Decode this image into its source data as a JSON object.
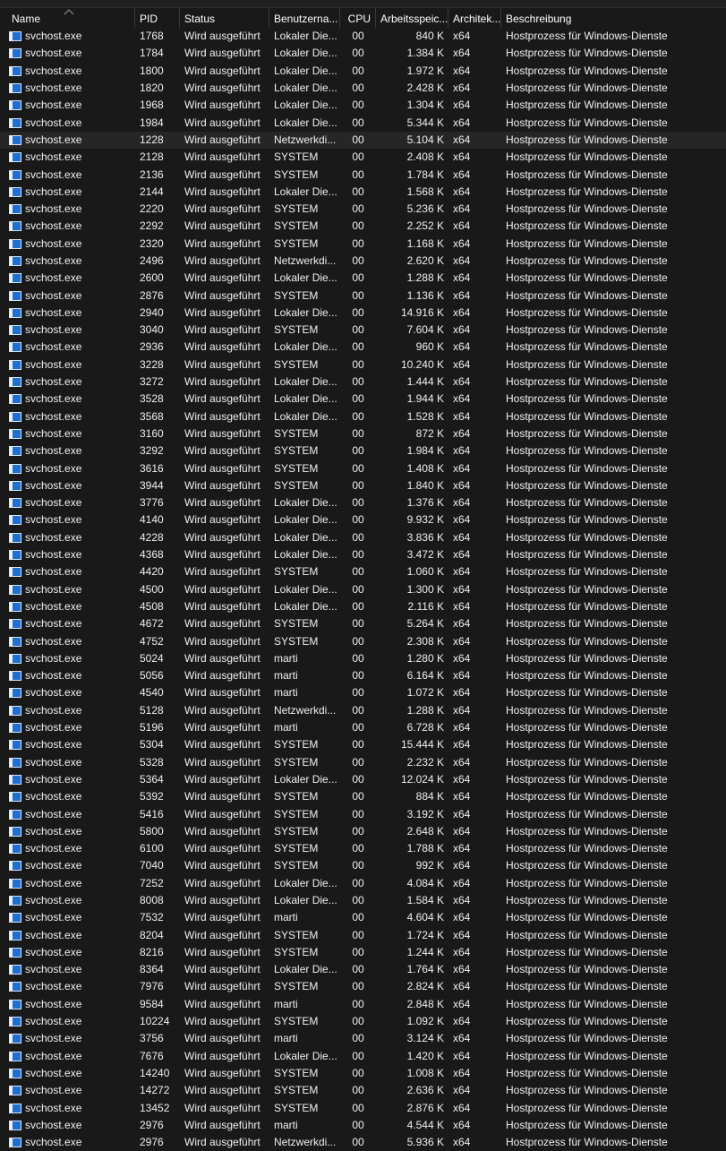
{
  "columns": {
    "name": "Name",
    "pid": "PID",
    "status": "Status",
    "user": "Benutzerna...",
    "cpu": "CPU",
    "memory": "Arbeitsspeic...",
    "arch": "Architek...",
    "description": "Beschreibung"
  },
  "sort_column": "Name",
  "icon_color": "#1f6fd1",
  "processes": [
    {
      "name": "svchost.exe",
      "pid": "1768",
      "status": "Wird ausgeführt",
      "user": "Lokaler Die...",
      "cpu": "00",
      "mem": "840 K",
      "arch": "x64",
      "desc": "Hostprozess für Windows-Dienste"
    },
    {
      "name": "svchost.exe",
      "pid": "1784",
      "status": "Wird ausgeführt",
      "user": "Lokaler Die...",
      "cpu": "00",
      "mem": "1.384 K",
      "arch": "x64",
      "desc": "Hostprozess für Windows-Dienste"
    },
    {
      "name": "svchost.exe",
      "pid": "1800",
      "status": "Wird ausgeführt",
      "user": "Lokaler Die...",
      "cpu": "00",
      "mem": "1.972 K",
      "arch": "x64",
      "desc": "Hostprozess für Windows-Dienste"
    },
    {
      "name": "svchost.exe",
      "pid": "1820",
      "status": "Wird ausgeführt",
      "user": "Lokaler Die...",
      "cpu": "00",
      "mem": "2.428 K",
      "arch": "x64",
      "desc": "Hostprozess für Windows-Dienste"
    },
    {
      "name": "svchost.exe",
      "pid": "1968",
      "status": "Wird ausgeführt",
      "user": "Lokaler Die...",
      "cpu": "00",
      "mem": "1.304 K",
      "arch": "x64",
      "desc": "Hostprozess für Windows-Dienste"
    },
    {
      "name": "svchost.exe",
      "pid": "1984",
      "status": "Wird ausgeführt",
      "user": "Lokaler Die...",
      "cpu": "00",
      "mem": "5.344 K",
      "arch": "x64",
      "desc": "Hostprozess für Windows-Dienste"
    },
    {
      "name": "svchost.exe",
      "pid": "1228",
      "status": "Wird ausgeführt",
      "user": "Netzwerkdi...",
      "cpu": "00",
      "mem": "5.104 K",
      "arch": "x64",
      "desc": "Hostprozess für Windows-Dienste",
      "selected": true
    },
    {
      "name": "svchost.exe",
      "pid": "2128",
      "status": "Wird ausgeführt",
      "user": "SYSTEM",
      "cpu": "00",
      "mem": "2.408 K",
      "arch": "x64",
      "desc": "Hostprozess für Windows-Dienste"
    },
    {
      "name": "svchost.exe",
      "pid": "2136",
      "status": "Wird ausgeführt",
      "user": "SYSTEM",
      "cpu": "00",
      "mem": "1.784 K",
      "arch": "x64",
      "desc": "Hostprozess für Windows-Dienste"
    },
    {
      "name": "svchost.exe",
      "pid": "2144",
      "status": "Wird ausgeführt",
      "user": "Lokaler Die...",
      "cpu": "00",
      "mem": "1.568 K",
      "arch": "x64",
      "desc": "Hostprozess für Windows-Dienste"
    },
    {
      "name": "svchost.exe",
      "pid": "2220",
      "status": "Wird ausgeführt",
      "user": "SYSTEM",
      "cpu": "00",
      "mem": "5.236 K",
      "arch": "x64",
      "desc": "Hostprozess für Windows-Dienste"
    },
    {
      "name": "svchost.exe",
      "pid": "2292",
      "status": "Wird ausgeführt",
      "user": "SYSTEM",
      "cpu": "00",
      "mem": "2.252 K",
      "arch": "x64",
      "desc": "Hostprozess für Windows-Dienste"
    },
    {
      "name": "svchost.exe",
      "pid": "2320",
      "status": "Wird ausgeführt",
      "user": "SYSTEM",
      "cpu": "00",
      "mem": "1.168 K",
      "arch": "x64",
      "desc": "Hostprozess für Windows-Dienste"
    },
    {
      "name": "svchost.exe",
      "pid": "2496",
      "status": "Wird ausgeführt",
      "user": "Netzwerkdi...",
      "cpu": "00",
      "mem": "2.620 K",
      "arch": "x64",
      "desc": "Hostprozess für Windows-Dienste"
    },
    {
      "name": "svchost.exe",
      "pid": "2600",
      "status": "Wird ausgeführt",
      "user": "Lokaler Die...",
      "cpu": "00",
      "mem": "1.288 K",
      "arch": "x64",
      "desc": "Hostprozess für Windows-Dienste"
    },
    {
      "name": "svchost.exe",
      "pid": "2876",
      "status": "Wird ausgeführt",
      "user": "SYSTEM",
      "cpu": "00",
      "mem": "1.136 K",
      "arch": "x64",
      "desc": "Hostprozess für Windows-Dienste"
    },
    {
      "name": "svchost.exe",
      "pid": "2940",
      "status": "Wird ausgeführt",
      "user": "Lokaler Die...",
      "cpu": "00",
      "mem": "14.916 K",
      "arch": "x64",
      "desc": "Hostprozess für Windows-Dienste"
    },
    {
      "name": "svchost.exe",
      "pid": "3040",
      "status": "Wird ausgeführt",
      "user": "SYSTEM",
      "cpu": "00",
      "mem": "7.604 K",
      "arch": "x64",
      "desc": "Hostprozess für Windows-Dienste"
    },
    {
      "name": "svchost.exe",
      "pid": "2936",
      "status": "Wird ausgeführt",
      "user": "Lokaler Die...",
      "cpu": "00",
      "mem": "960 K",
      "arch": "x64",
      "desc": "Hostprozess für Windows-Dienste"
    },
    {
      "name": "svchost.exe",
      "pid": "3228",
      "status": "Wird ausgeführt",
      "user": "SYSTEM",
      "cpu": "00",
      "mem": "10.240 K",
      "arch": "x64",
      "desc": "Hostprozess für Windows-Dienste"
    },
    {
      "name": "svchost.exe",
      "pid": "3272",
      "status": "Wird ausgeführt",
      "user": "Lokaler Die...",
      "cpu": "00",
      "mem": "1.444 K",
      "arch": "x64",
      "desc": "Hostprozess für Windows-Dienste"
    },
    {
      "name": "svchost.exe",
      "pid": "3528",
      "status": "Wird ausgeführt",
      "user": "Lokaler Die...",
      "cpu": "00",
      "mem": "1.944 K",
      "arch": "x64",
      "desc": "Hostprozess für Windows-Dienste"
    },
    {
      "name": "svchost.exe",
      "pid": "3568",
      "status": "Wird ausgeführt",
      "user": "Lokaler Die...",
      "cpu": "00",
      "mem": "1.528 K",
      "arch": "x64",
      "desc": "Hostprozess für Windows-Dienste"
    },
    {
      "name": "svchost.exe",
      "pid": "3160",
      "status": "Wird ausgeführt",
      "user": "SYSTEM",
      "cpu": "00",
      "mem": "872 K",
      "arch": "x64",
      "desc": "Hostprozess für Windows-Dienste"
    },
    {
      "name": "svchost.exe",
      "pid": "3292",
      "status": "Wird ausgeführt",
      "user": "SYSTEM",
      "cpu": "00",
      "mem": "1.984 K",
      "arch": "x64",
      "desc": "Hostprozess für Windows-Dienste"
    },
    {
      "name": "svchost.exe",
      "pid": "3616",
      "status": "Wird ausgeführt",
      "user": "SYSTEM",
      "cpu": "00",
      "mem": "1.408 K",
      "arch": "x64",
      "desc": "Hostprozess für Windows-Dienste"
    },
    {
      "name": "svchost.exe",
      "pid": "3944",
      "status": "Wird ausgeführt",
      "user": "SYSTEM",
      "cpu": "00",
      "mem": "1.840 K",
      "arch": "x64",
      "desc": "Hostprozess für Windows-Dienste"
    },
    {
      "name": "svchost.exe",
      "pid": "3776",
      "status": "Wird ausgeführt",
      "user": "Lokaler Die...",
      "cpu": "00",
      "mem": "1.376 K",
      "arch": "x64",
      "desc": "Hostprozess für Windows-Dienste"
    },
    {
      "name": "svchost.exe",
      "pid": "4140",
      "status": "Wird ausgeführt",
      "user": "Lokaler Die...",
      "cpu": "00",
      "mem": "9.932 K",
      "arch": "x64",
      "desc": "Hostprozess für Windows-Dienste"
    },
    {
      "name": "svchost.exe",
      "pid": "4228",
      "status": "Wird ausgeführt",
      "user": "Lokaler Die...",
      "cpu": "00",
      "mem": "3.836 K",
      "arch": "x64",
      "desc": "Hostprozess für Windows-Dienste"
    },
    {
      "name": "svchost.exe",
      "pid": "4368",
      "status": "Wird ausgeführt",
      "user": "Lokaler Die...",
      "cpu": "00",
      "mem": "3.472 K",
      "arch": "x64",
      "desc": "Hostprozess für Windows-Dienste"
    },
    {
      "name": "svchost.exe",
      "pid": "4420",
      "status": "Wird ausgeführt",
      "user": "SYSTEM",
      "cpu": "00",
      "mem": "1.060 K",
      "arch": "x64",
      "desc": "Hostprozess für Windows-Dienste"
    },
    {
      "name": "svchost.exe",
      "pid": "4500",
      "status": "Wird ausgeführt",
      "user": "Lokaler Die...",
      "cpu": "00",
      "mem": "1.300 K",
      "arch": "x64",
      "desc": "Hostprozess für Windows-Dienste"
    },
    {
      "name": "svchost.exe",
      "pid": "4508",
      "status": "Wird ausgeführt",
      "user": "Lokaler Die...",
      "cpu": "00",
      "mem": "2.116 K",
      "arch": "x64",
      "desc": "Hostprozess für Windows-Dienste"
    },
    {
      "name": "svchost.exe",
      "pid": "4672",
      "status": "Wird ausgeführt",
      "user": "SYSTEM",
      "cpu": "00",
      "mem": "5.264 K",
      "arch": "x64",
      "desc": "Hostprozess für Windows-Dienste"
    },
    {
      "name": "svchost.exe",
      "pid": "4752",
      "status": "Wird ausgeführt",
      "user": "SYSTEM",
      "cpu": "00",
      "mem": "2.308 K",
      "arch": "x64",
      "desc": "Hostprozess für Windows-Dienste"
    },
    {
      "name": "svchost.exe",
      "pid": "5024",
      "status": "Wird ausgeführt",
      "user": "marti",
      "cpu": "00",
      "mem": "1.280 K",
      "arch": "x64",
      "desc": "Hostprozess für Windows-Dienste"
    },
    {
      "name": "svchost.exe",
      "pid": "5056",
      "status": "Wird ausgeführt",
      "user": "marti",
      "cpu": "00",
      "mem": "6.164 K",
      "arch": "x64",
      "desc": "Hostprozess für Windows-Dienste"
    },
    {
      "name": "svchost.exe",
      "pid": "4540",
      "status": "Wird ausgeführt",
      "user": "marti",
      "cpu": "00",
      "mem": "1.072 K",
      "arch": "x64",
      "desc": "Hostprozess für Windows-Dienste"
    },
    {
      "name": "svchost.exe",
      "pid": "5128",
      "status": "Wird ausgeführt",
      "user": "Netzwerkdi...",
      "cpu": "00",
      "mem": "1.288 K",
      "arch": "x64",
      "desc": "Hostprozess für Windows-Dienste"
    },
    {
      "name": "svchost.exe",
      "pid": "5196",
      "status": "Wird ausgeführt",
      "user": "marti",
      "cpu": "00",
      "mem": "6.728 K",
      "arch": "x64",
      "desc": "Hostprozess für Windows-Dienste"
    },
    {
      "name": "svchost.exe",
      "pid": "5304",
      "status": "Wird ausgeführt",
      "user": "SYSTEM",
      "cpu": "00",
      "mem": "15.444 K",
      "arch": "x64",
      "desc": "Hostprozess für Windows-Dienste"
    },
    {
      "name": "svchost.exe",
      "pid": "5328",
      "status": "Wird ausgeführt",
      "user": "SYSTEM",
      "cpu": "00",
      "mem": "2.232 K",
      "arch": "x64",
      "desc": "Hostprozess für Windows-Dienste"
    },
    {
      "name": "svchost.exe",
      "pid": "5364",
      "status": "Wird ausgeführt",
      "user": "Lokaler Die...",
      "cpu": "00",
      "mem": "12.024 K",
      "arch": "x64",
      "desc": "Hostprozess für Windows-Dienste"
    },
    {
      "name": "svchost.exe",
      "pid": "5392",
      "status": "Wird ausgeführt",
      "user": "SYSTEM",
      "cpu": "00",
      "mem": "884 K",
      "arch": "x64",
      "desc": "Hostprozess für Windows-Dienste"
    },
    {
      "name": "svchost.exe",
      "pid": "5416",
      "status": "Wird ausgeführt",
      "user": "SYSTEM",
      "cpu": "00",
      "mem": "3.192 K",
      "arch": "x64",
      "desc": "Hostprozess für Windows-Dienste"
    },
    {
      "name": "svchost.exe",
      "pid": "5800",
      "status": "Wird ausgeführt",
      "user": "SYSTEM",
      "cpu": "00",
      "mem": "2.648 K",
      "arch": "x64",
      "desc": "Hostprozess für Windows-Dienste"
    },
    {
      "name": "svchost.exe",
      "pid": "6100",
      "status": "Wird ausgeführt",
      "user": "SYSTEM",
      "cpu": "00",
      "mem": "1.788 K",
      "arch": "x64",
      "desc": "Hostprozess für Windows-Dienste"
    },
    {
      "name": "svchost.exe",
      "pid": "7040",
      "status": "Wird ausgeführt",
      "user": "SYSTEM",
      "cpu": "00",
      "mem": "992 K",
      "arch": "x64",
      "desc": "Hostprozess für Windows-Dienste"
    },
    {
      "name": "svchost.exe",
      "pid": "7252",
      "status": "Wird ausgeführt",
      "user": "Lokaler Die...",
      "cpu": "00",
      "mem": "4.084 K",
      "arch": "x64",
      "desc": "Hostprozess für Windows-Dienste"
    },
    {
      "name": "svchost.exe",
      "pid": "8008",
      "status": "Wird ausgeführt",
      "user": "Lokaler Die...",
      "cpu": "00",
      "mem": "1.584 K",
      "arch": "x64",
      "desc": "Hostprozess für Windows-Dienste"
    },
    {
      "name": "svchost.exe",
      "pid": "7532",
      "status": "Wird ausgeführt",
      "user": "marti",
      "cpu": "00",
      "mem": "4.604 K",
      "arch": "x64",
      "desc": "Hostprozess für Windows-Dienste"
    },
    {
      "name": "svchost.exe",
      "pid": "8204",
      "status": "Wird ausgeführt",
      "user": "SYSTEM",
      "cpu": "00",
      "mem": "1.724 K",
      "arch": "x64",
      "desc": "Hostprozess für Windows-Dienste"
    },
    {
      "name": "svchost.exe",
      "pid": "8216",
      "status": "Wird ausgeführt",
      "user": "SYSTEM",
      "cpu": "00",
      "mem": "1.244 K",
      "arch": "x64",
      "desc": "Hostprozess für Windows-Dienste"
    },
    {
      "name": "svchost.exe",
      "pid": "8364",
      "status": "Wird ausgeführt",
      "user": "Lokaler Die...",
      "cpu": "00",
      "mem": "1.764 K",
      "arch": "x64",
      "desc": "Hostprozess für Windows-Dienste"
    },
    {
      "name": "svchost.exe",
      "pid": "7976",
      "status": "Wird ausgeführt",
      "user": "SYSTEM",
      "cpu": "00",
      "mem": "2.824 K",
      "arch": "x64",
      "desc": "Hostprozess für Windows-Dienste"
    },
    {
      "name": "svchost.exe",
      "pid": "9584",
      "status": "Wird ausgeführt",
      "user": "marti",
      "cpu": "00",
      "mem": "2.848 K",
      "arch": "x64",
      "desc": "Hostprozess für Windows-Dienste"
    },
    {
      "name": "svchost.exe",
      "pid": "10224",
      "status": "Wird ausgeführt",
      "user": "SYSTEM",
      "cpu": "00",
      "mem": "1.092 K",
      "arch": "x64",
      "desc": "Hostprozess für Windows-Dienste"
    },
    {
      "name": "svchost.exe",
      "pid": "3756",
      "status": "Wird ausgeführt",
      "user": "marti",
      "cpu": "00",
      "mem": "3.124 K",
      "arch": "x64",
      "desc": "Hostprozess für Windows-Dienste"
    },
    {
      "name": "svchost.exe",
      "pid": "7676",
      "status": "Wird ausgeführt",
      "user": "Lokaler Die...",
      "cpu": "00",
      "mem": "1.420 K",
      "arch": "x64",
      "desc": "Hostprozess für Windows-Dienste"
    },
    {
      "name": "svchost.exe",
      "pid": "14240",
      "status": "Wird ausgeführt",
      "user": "SYSTEM",
      "cpu": "00",
      "mem": "1.008 K",
      "arch": "x64",
      "desc": "Hostprozess für Windows-Dienste"
    },
    {
      "name": "svchost.exe",
      "pid": "14272",
      "status": "Wird ausgeführt",
      "user": "SYSTEM",
      "cpu": "00",
      "mem": "2.636 K",
      "arch": "x64",
      "desc": "Hostprozess für Windows-Dienste"
    },
    {
      "name": "svchost.exe",
      "pid": "13452",
      "status": "Wird ausgeführt",
      "user": "SYSTEM",
      "cpu": "00",
      "mem": "2.876 K",
      "arch": "x64",
      "desc": "Hostprozess für Windows-Dienste"
    },
    {
      "name": "svchost.exe",
      "pid": "2976",
      "status": "Wird ausgeführt",
      "user": "marti",
      "cpu": "00",
      "mem": "4.544 K",
      "arch": "x64",
      "desc": "Hostprozess für Windows-Dienste"
    },
    {
      "name": "svchost.exe",
      "pid": "2976",
      "status": "Wird ausgeführt",
      "user": "Netzwerkdi...",
      "cpu": "00",
      "mem": "5.936 K",
      "arch": "x64",
      "desc": "Hostprozess für Windows-Dienste"
    }
  ]
}
